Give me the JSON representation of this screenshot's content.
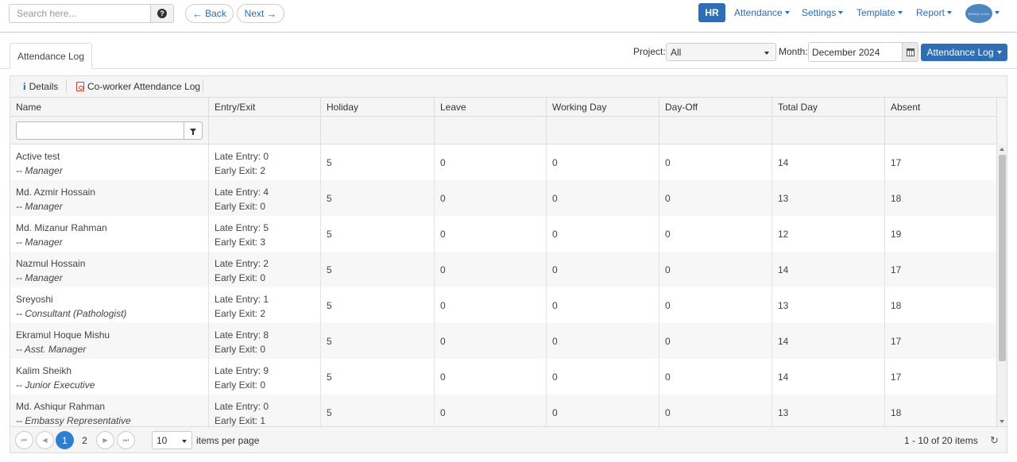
{
  "nav": {
    "search_placeholder": "Search here...",
    "search_button_glyph": "?",
    "back_label": "Back",
    "next_label": "Next",
    "hr_label": "HR",
    "menus": [
      "Attendance",
      "Settings",
      "Template",
      "Report"
    ],
    "avatar_text": "BRAND LOGO"
  },
  "tab": {
    "label": "Attendance Log"
  },
  "filters": {
    "project_label": "Project:",
    "project_value": "All",
    "month_label": "Month:",
    "month_value": "December 2024",
    "log_button": "Attendance Log"
  },
  "toolbar": {
    "details_label": "Details",
    "coworker_label": "Co-worker Attendance Log"
  },
  "grid": {
    "columns": [
      "Name",
      "Entry/Exit",
      "Holiday",
      "Leave",
      "Working Day",
      "Day-Off",
      "Total Day",
      "Absent"
    ],
    "rows": [
      {
        "name": "Active test",
        "role": "-- Manager",
        "entry": "Late Entry: 0",
        "exit": "Early Exit: 2",
        "holiday": "5",
        "leave": "0",
        "working": "0",
        "dayoff": "0",
        "total": "14",
        "absent": "17"
      },
      {
        "name": "Md. Azmir Hossain",
        "role": "-- Manager",
        "entry": "Late Entry: 4",
        "exit": "Early Exit: 0",
        "holiday": "5",
        "leave": "0",
        "working": "0",
        "dayoff": "0",
        "total": "13",
        "absent": "18"
      },
      {
        "name": "Md. Mizanur Rahman",
        "role": "-- Manager",
        "entry": "Late Entry: 5",
        "exit": "Early Exit: 3",
        "holiday": "5",
        "leave": "0",
        "working": "0",
        "dayoff": "0",
        "total": "12",
        "absent": "19"
      },
      {
        "name": "Nazmul Hossain",
        "role": "-- Manager",
        "entry": "Late Entry: 2",
        "exit": "Early Exit: 0",
        "holiday": "5",
        "leave": "0",
        "working": "0",
        "dayoff": "0",
        "total": "14",
        "absent": "17"
      },
      {
        "name": "Sreyoshi",
        "role": "-- Consultant (Pathologist)",
        "entry": "Late Entry: 1",
        "exit": "Early Exit: 2",
        "holiday": "5",
        "leave": "0",
        "working": "0",
        "dayoff": "0",
        "total": "13",
        "absent": "18"
      },
      {
        "name": "Ekramul Hoque Mishu",
        "role": "-- Asst. Manager",
        "entry": "Late Entry: 8",
        "exit": "Early Exit: 0",
        "holiday": "5",
        "leave": "0",
        "working": "0",
        "dayoff": "0",
        "total": "14",
        "absent": "17"
      },
      {
        "name": "Kalim Sheikh",
        "role": "-- Junior Executive",
        "entry": "Late Entry: 9",
        "exit": "Early Exit: 0",
        "holiday": "5",
        "leave": "0",
        "working": "0",
        "dayoff": "0",
        "total": "14",
        "absent": "17"
      },
      {
        "name": "Md. Ashiqur Rahman",
        "role": "-- Embassy Representative",
        "entry": "Late Entry: 0",
        "exit": "Early Exit: 1",
        "holiday": "5",
        "leave": "0",
        "working": "0",
        "dayoff": "0",
        "total": "13",
        "absent": "18"
      }
    ]
  },
  "pager": {
    "pages": [
      "1",
      "2"
    ],
    "current_page": "1",
    "page_size": "10",
    "items_per_page_label": "items per page",
    "summary": "1 - 10 of 20 items"
  },
  "colors": {
    "primary": "#2f6db5",
    "link": "#2b6cb0",
    "active_page": "#2f7fd0",
    "pdf": "#d9372b"
  }
}
